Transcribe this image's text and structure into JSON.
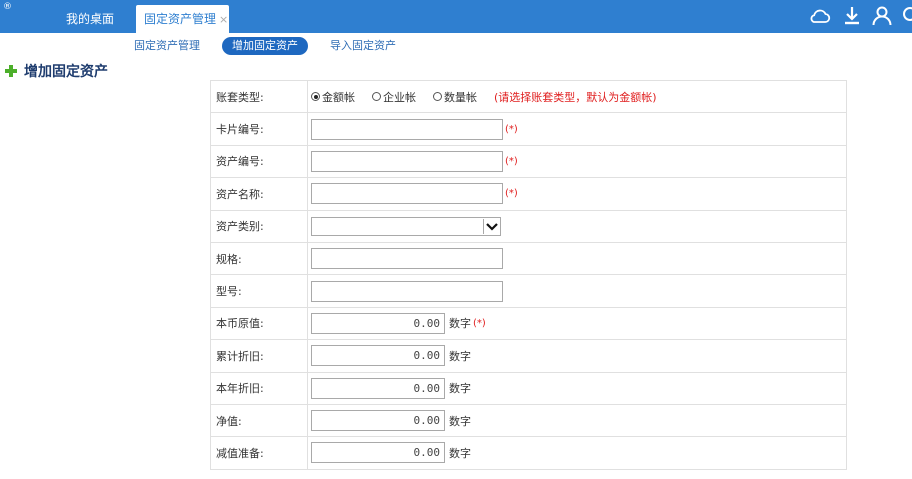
{
  "topbar": {
    "tabs": [
      {
        "label": "我的桌面"
      },
      {
        "label": "固定资产管理",
        "close": "×"
      }
    ],
    "icons": [
      "cloud-icon",
      "download-icon",
      "user-icon",
      "search-icon"
    ]
  },
  "subnav": {
    "items": [
      {
        "label": "固定资产管理"
      },
      {
        "label": "增加固定资产"
      },
      {
        "label": "导入固定资产"
      }
    ]
  },
  "page": {
    "title": "增加固定资产"
  },
  "form": {
    "account_type": {
      "label": "账套类型:",
      "options": [
        "金额帐",
        "企业帐",
        "数量帐"
      ],
      "selected": "金额帐",
      "hint": "(请选择账套类型，默认为金额帐)"
    },
    "card_no": {
      "label": "卡片编号:",
      "value": "",
      "required": "(*)"
    },
    "asset_no": {
      "label": "资产编号:",
      "value": "",
      "required": "(*)"
    },
    "asset_name": {
      "label": "资产名称:",
      "value": "",
      "required": "(*)"
    },
    "asset_category": {
      "label": "资产类别:",
      "value": ""
    },
    "spec": {
      "label": "规格:",
      "value": ""
    },
    "model": {
      "label": "型号:",
      "value": ""
    },
    "original_value": {
      "label": "本币原值:",
      "value": "0.00",
      "unit": "数字",
      "required": "(*)"
    },
    "accum_depreciation": {
      "label": "累计折旧:",
      "value": "0.00",
      "unit": "数字"
    },
    "year_depreciation": {
      "label": "本年折旧:",
      "value": "0.00",
      "unit": "数字"
    },
    "net_value": {
      "label": "净值:",
      "value": "0.00",
      "unit": "数字"
    },
    "impairment": {
      "label": "减值准备:",
      "value": "0.00",
      "unit": "数字"
    }
  },
  "colors": {
    "topbar": "#2f7fd0",
    "accent": "#1e68c0",
    "required": "#e02020"
  }
}
